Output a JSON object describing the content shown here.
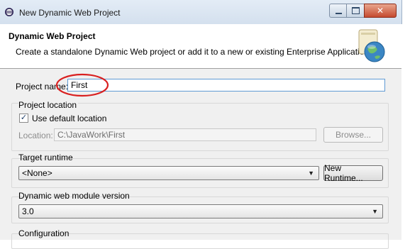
{
  "window": {
    "title": "New Dynamic Web Project",
    "close_glyph": "✕"
  },
  "banner": {
    "title": "Dynamic Web Project",
    "description": "Create a standalone Dynamic Web project or add it to a new or existing Enterprise Application."
  },
  "form": {
    "project_name_label": "Project name:",
    "project_name_value": "First",
    "project_location": {
      "group_label": "Project location",
      "use_default_label": "Use default location",
      "use_default_checked": true,
      "location_label": "Location:",
      "location_value": "C:\\JavaWork\\First",
      "browse_label": "Browse..."
    },
    "target_runtime": {
      "group_label": "Target runtime",
      "selected": "<None>",
      "new_runtime_label": "New Runtime..."
    },
    "module_version": {
      "group_label": "Dynamic web module version",
      "selected": "3.0"
    },
    "configuration": {
      "group_label": "Configuration"
    }
  },
  "annotation": {
    "highlight_color": "#d92020"
  },
  "icons": {
    "app": "eclipse-icon",
    "banner": "web-project-globe-icon",
    "dropdown": "chevron-down-icon",
    "check": "checkmark-icon"
  }
}
